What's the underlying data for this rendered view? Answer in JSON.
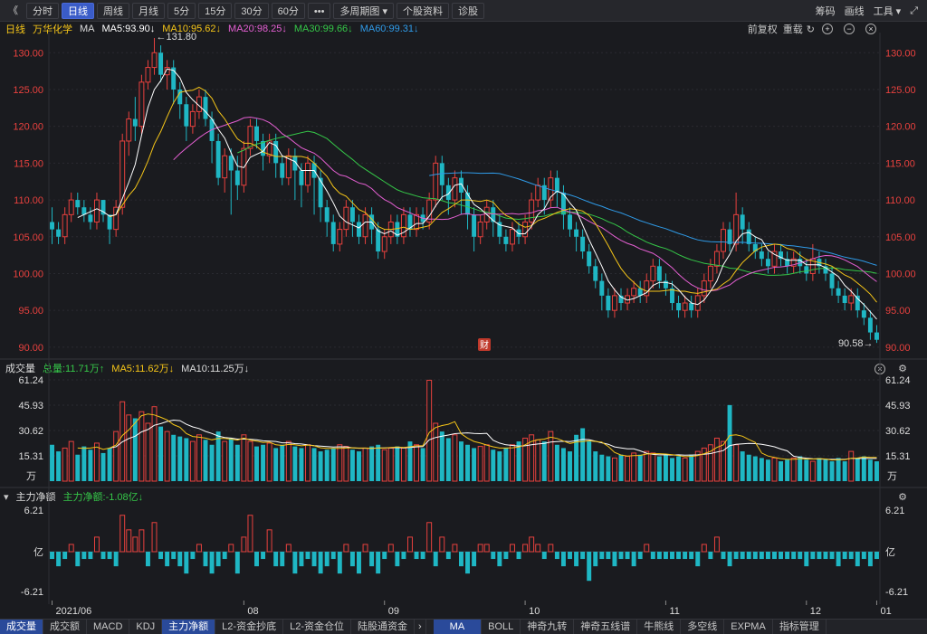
{
  "toolbar": {
    "back": "《",
    "buttons": [
      "分时",
      "日线",
      "周线",
      "月线",
      "5分",
      "15分",
      "30分",
      "60分",
      "•••",
      "多周期图 ▾",
      "个股资料",
      "诊股"
    ],
    "active_index": 1,
    "right": [
      "筹码",
      "画线",
      "工具 ▾"
    ]
  },
  "kline_legend": {
    "period": "日线",
    "stock": "万华化学",
    "ma_label": "MA",
    "ma5": "MA5:93.90↓",
    "ma10": "MA10:95.62↓",
    "ma20": "MA20:98.25↓",
    "ma30": "MA30:99.66↓",
    "ma60": "MA60:99.31↓",
    "right_a": "前复权",
    "right_b": "重载"
  },
  "kline_axis": {
    "ticks": [
      "130.00",
      "125.00",
      "120.00",
      "115.00",
      "110.00",
      "105.00",
      "100.00",
      "95.00",
      "90.00"
    ],
    "high_label": "←131.80",
    "low_label": "90.58→",
    "cai_badge": "财"
  },
  "volume_legend": {
    "title": "成交量",
    "total": "总量:11.71万↑",
    "ma5": "MA5:11.62万↓",
    "ma10": "MA10:11.25万↓"
  },
  "volume_axis": {
    "ticks": [
      "61.24",
      "45.93",
      "30.62",
      "15.31"
    ],
    "unit": "万"
  },
  "fund_legend": {
    "title": "主力净额",
    "value": "主力净额:-1.08亿↓"
  },
  "fund_axis": {
    "top": "6.21",
    "mid": "亿",
    "bottom": "-6.21"
  },
  "x_axis": {
    "labels": [
      "2021/06",
      "08",
      "09",
      "10",
      "11",
      "12",
      "01"
    ]
  },
  "bottom_tabs": [
    "成交量",
    "成交额",
    "MACD",
    "KDJ",
    "主力净额",
    "L2-资金抄底",
    "L2-资金仓位",
    "陆股通资金"
  ],
  "bottom_tabs_right": [
    "MA",
    "BOLL",
    "神奇九转",
    "神奇五线谱",
    "牛熊线",
    "多空线",
    "EXPMA",
    "指标管理"
  ],
  "colors": {
    "up": "#e8413e",
    "down": "#1fb7c4",
    "ma5": "#ffffff",
    "ma10": "#f5c518",
    "ma20": "#e45fd2",
    "ma30": "#35c748",
    "ma60": "#2f9be8"
  },
  "chart_data": {
    "type": "candlestick",
    "ylim": [
      89,
      132
    ],
    "candles": [
      [
        107,
        106,
        109,
        104
      ],
      [
        106,
        105,
        107,
        104
      ],
      [
        105,
        108,
        109,
        104
      ],
      [
        108,
        110,
        111,
        107
      ],
      [
        110,
        109,
        111,
        108
      ],
      [
        109,
        108,
        110,
        107
      ],
      [
        108,
        107,
        109,
        106
      ],
      [
        107,
        110,
        111,
        106
      ],
      [
        110,
        108,
        110,
        107
      ],
      [
        108,
        106,
        108,
        104
      ],
      [
        106,
        109,
        110,
        105
      ],
      [
        109,
        118,
        119,
        108
      ],
      [
        118,
        121,
        122,
        116
      ],
      [
        121,
        120,
        124,
        118
      ],
      [
        120,
        126,
        127,
        119
      ],
      [
        126,
        128,
        129,
        125
      ],
      [
        128,
        130,
        132,
        127
      ],
      [
        130,
        127,
        131,
        126
      ],
      [
        127,
        128,
        129,
        125
      ],
      [
        128,
        125,
        129,
        123
      ],
      [
        125,
        123,
        126,
        121
      ],
      [
        123,
        120,
        124,
        118
      ],
      [
        120,
        122,
        123,
        119
      ],
      [
        122,
        124,
        125,
        121
      ],
      [
        124,
        121,
        125,
        120
      ],
      [
        121,
        118,
        122,
        115
      ],
      [
        118,
        113,
        119,
        112
      ],
      [
        113,
        116,
        117,
        111
      ],
      [
        116,
        114,
        117,
        108
      ],
      [
        114,
        112,
        116,
        110
      ],
      [
        112,
        117,
        118,
        111
      ],
      [
        117,
        120,
        121,
        116
      ],
      [
        120,
        118,
        121,
        117
      ],
      [
        118,
        116,
        119,
        114
      ],
      [
        116,
        118,
        119,
        115
      ],
      [
        118,
        115,
        119,
        113
      ],
      [
        115,
        113,
        116,
        112
      ],
      [
        113,
        116,
        117,
        112
      ],
      [
        116,
        114,
        117,
        110
      ],
      [
        114,
        112,
        115,
        109
      ],
      [
        112,
        115,
        116,
        111
      ],
      [
        115,
        113,
        116,
        108
      ],
      [
        113,
        109,
        114,
        107
      ],
      [
        109,
        107,
        110,
        105
      ],
      [
        107,
        104,
        108,
        103
      ],
      [
        104,
        106,
        107,
        103
      ],
      [
        106,
        109,
        110,
        105
      ],
      [
        109,
        107,
        110,
        105
      ],
      [
        107,
        105,
        108,
        104
      ],
      [
        105,
        108,
        109,
        104
      ],
      [
        108,
        106,
        109,
        104
      ],
      [
        106,
        103,
        107,
        102
      ],
      [
        103,
        105,
        106,
        102
      ],
      [
        105,
        107,
        108,
        104
      ],
      [
        107,
        105,
        108,
        104
      ],
      [
        105,
        108,
        109,
        104
      ],
      [
        108,
        106,
        109,
        105
      ],
      [
        106,
        108,
        109,
        105
      ],
      [
        108,
        107,
        109,
        106
      ],
      [
        107,
        110,
        111,
        106
      ],
      [
        110,
        115,
        116,
        109
      ],
      [
        115,
        112,
        116,
        110
      ],
      [
        112,
        110,
        113,
        108
      ],
      [
        110,
        113,
        114,
        109
      ],
      [
        113,
        111,
        114,
        108
      ],
      [
        111,
        108,
        112,
        106
      ],
      [
        108,
        105,
        109,
        103
      ],
      [
        105,
        107,
        108,
        104
      ],
      [
        107,
        109,
        110,
        106
      ],
      [
        109,
        107,
        110,
        105
      ],
      [
        107,
        105,
        108,
        104
      ],
      [
        105,
        104,
        106,
        103
      ],
      [
        104,
        106,
        107,
        103
      ],
      [
        106,
        105,
        107,
        104
      ],
      [
        105,
        107,
        108,
        104
      ],
      [
        107,
        110,
        111,
        106
      ],
      [
        110,
        112,
        113,
        109
      ],
      [
        112,
        110,
        113,
        108
      ],
      [
        110,
        113,
        114,
        109
      ],
      [
        113,
        111,
        114,
        109
      ],
      [
        111,
        108,
        112,
        106
      ],
      [
        108,
        106,
        109,
        105
      ],
      [
        106,
        105,
        107,
        103
      ],
      [
        105,
        103,
        106,
        102
      ],
      [
        103,
        101,
        104,
        100
      ],
      [
        101,
        99,
        102,
        98
      ],
      [
        99,
        97,
        100,
        95
      ],
      [
        97,
        95,
        98,
        94
      ],
      [
        95,
        97,
        98,
        94
      ],
      [
        97,
        96,
        98,
        95
      ],
      [
        96,
        97,
        98,
        95
      ],
      [
        97,
        98,
        99,
        96
      ],
      [
        98,
        97,
        99,
        96
      ],
      [
        97,
        99,
        100,
        96
      ],
      [
        99,
        101,
        102,
        98
      ],
      [
        101,
        99,
        102,
        98
      ],
      [
        99,
        98,
        100,
        97
      ],
      [
        98,
        96,
        99,
        95
      ],
      [
        96,
        95,
        97,
        94
      ],
      [
        95,
        96,
        97,
        94
      ],
      [
        96,
        95,
        97,
        94
      ],
      [
        95,
        97,
        98,
        94
      ],
      [
        97,
        99,
        100,
        96
      ],
      [
        99,
        101,
        102,
        98
      ],
      [
        101,
        103,
        104,
        100
      ],
      [
        103,
        106,
        107,
        102
      ],
      [
        106,
        104,
        107,
        103
      ],
      [
        104,
        108,
        111,
        103
      ],
      [
        108,
        106,
        109,
        104
      ],
      [
        106,
        104,
        107,
        103
      ],
      [
        104,
        103,
        105,
        102
      ],
      [
        103,
        102,
        104,
        101
      ],
      [
        102,
        101,
        103,
        100
      ],
      [
        101,
        103,
        104,
        100
      ],
      [
        103,
        102,
        104,
        101
      ],
      [
        102,
        101,
        103,
        100
      ],
      [
        101,
        102,
        103,
        100
      ],
      [
        102,
        101,
        103,
        100
      ],
      [
        101,
        100,
        102,
        99
      ],
      [
        100,
        102,
        104,
        99
      ],
      [
        102,
        101,
        103,
        100
      ],
      [
        101,
        100,
        102,
        99
      ],
      [
        100,
        98,
        101,
        97
      ],
      [
        98,
        97,
        99,
        96
      ],
      [
        97,
        96,
        98,
        95
      ],
      [
        96,
        97,
        98,
        95
      ],
      [
        97,
        95,
        98,
        94
      ],
      [
        95,
        94,
        96,
        93
      ],
      [
        94,
        92,
        95,
        91
      ],
      [
        92,
        91,
        93,
        90.58
      ]
    ],
    "volumes": [
      22,
      18,
      20,
      24,
      16,
      21,
      19,
      23,
      17,
      20,
      30,
      48,
      40,
      38,
      42,
      35,
      45,
      33,
      30,
      28,
      27,
      26,
      24,
      28,
      25,
      22,
      30,
      24,
      26,
      22,
      28,
      24,
      21,
      22,
      23,
      20,
      22,
      24,
      21,
      20,
      22,
      20,
      18,
      19,
      20,
      22,
      21,
      19,
      18,
      20,
      21,
      22,
      19,
      20,
      21,
      20,
      24,
      22,
      20,
      61,
      35,
      30,
      26,
      28,
      24,
      22,
      20,
      21,
      22,
      19,
      18,
      20,
      22,
      24,
      26,
      28,
      25,
      24,
      30,
      22,
      20,
      18,
      28,
      32,
      24,
      18,
      16,
      15,
      14,
      16,
      15,
      17,
      16,
      18,
      17,
      15,
      16,
      14,
      15,
      14,
      16,
      18,
      20,
      22,
      26,
      24,
      46,
      22,
      18,
      16,
      15,
      14,
      13,
      14,
      12,
      13,
      14,
      15,
      13,
      12,
      14,
      13,
      12,
      14,
      12,
      18,
      14,
      15,
      13,
      12
    ],
    "fund": [
      -1,
      -2,
      -1,
      1,
      -2,
      -1,
      -1,
      2,
      -1,
      -1,
      -2,
      5,
      3,
      2,
      3,
      -2,
      4,
      -1,
      -2,
      -1,
      -2,
      -3,
      -1,
      1,
      -2,
      -3,
      -2,
      -1,
      1,
      -3,
      2,
      5,
      -2,
      -1,
      3,
      -2,
      -2,
      1,
      -3,
      -2,
      -1,
      -2,
      -3,
      -2,
      -1,
      -3,
      1,
      -2,
      -3,
      1,
      -2,
      -3,
      -1,
      1,
      -2,
      -1,
      2,
      -1,
      -1,
      4,
      -2,
      2,
      -1,
      1,
      -2,
      -3,
      -2,
      1,
      1,
      -1,
      -2,
      -1,
      1,
      -1,
      1,
      2,
      1,
      -1,
      1,
      -1,
      -2,
      -1,
      -2,
      -1,
      -4,
      -2,
      -1,
      -1,
      -2,
      -1,
      -1,
      -2,
      -1,
      1,
      -1,
      -1,
      -1,
      -1,
      -1,
      -1,
      -1,
      -2,
      1,
      -1,
      2,
      -1,
      -2,
      -1,
      -1,
      -1,
      -1,
      -1,
      -1,
      -1,
      -1,
      -1,
      -1,
      -1,
      -2,
      -1,
      -1,
      -1,
      -1,
      -2,
      -1,
      -1,
      -2,
      -1,
      -2,
      -1
    ]
  }
}
